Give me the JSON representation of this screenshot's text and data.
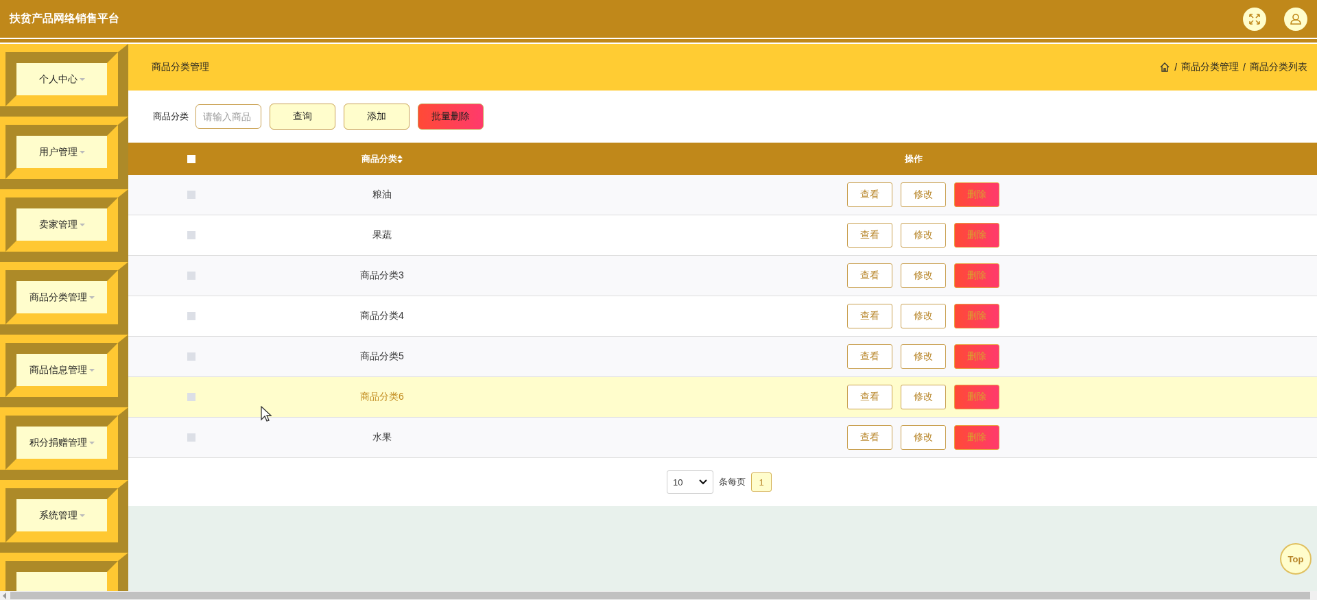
{
  "app": {
    "title": "扶贫产品网络销售平台"
  },
  "sidebar": {
    "items": [
      {
        "label": "个人中心"
      },
      {
        "label": "用户管理"
      },
      {
        "label": "卖家管理"
      },
      {
        "label": "商品分类管理"
      },
      {
        "label": "商品信息管理"
      },
      {
        "label": "积分捐赠管理"
      },
      {
        "label": "系统管理"
      }
    ]
  },
  "page_header": {
    "title": "商品分类管理",
    "breadcrumb": [
      {
        "separator": "/",
        "label": "商品分类管理"
      },
      {
        "separator": "/",
        "label": "商品分类列表"
      }
    ]
  },
  "search": {
    "label": "商品分类",
    "placeholder": "请输入商品"
  },
  "toolbar_buttons": [
    {
      "label": "查询",
      "kind": "normal"
    },
    {
      "label": "添加",
      "kind": "normal"
    },
    {
      "label": "批量删除",
      "kind": "danger"
    }
  ],
  "table": {
    "all_checked": false,
    "columns": [
      "商品分类",
      "操作"
    ],
    "rows": [
      {
        "name": "粮油",
        "checked": false,
        "hovered": false,
        "actions": [
          {
            "label": "查看",
            "kind": "view"
          },
          {
            "label": "修改",
            "kind": "edit"
          },
          {
            "label": "删除",
            "kind": "delete"
          }
        ]
      },
      {
        "name": "果蔬",
        "checked": false,
        "hovered": false,
        "actions": [
          {
            "label": "查看",
            "kind": "view"
          },
          {
            "label": "修改",
            "kind": "edit"
          },
          {
            "label": "删除",
            "kind": "delete"
          }
        ]
      },
      {
        "name": "商品分类3",
        "checked": false,
        "hovered": false,
        "actions": [
          {
            "label": "查看",
            "kind": "view"
          },
          {
            "label": "修改",
            "kind": "edit"
          },
          {
            "label": "删除",
            "kind": "delete"
          }
        ]
      },
      {
        "name": "商品分类4",
        "checked": false,
        "hovered": false,
        "actions": [
          {
            "label": "查看",
            "kind": "view"
          },
          {
            "label": "修改",
            "kind": "edit"
          },
          {
            "label": "删除",
            "kind": "delete"
          }
        ]
      },
      {
        "name": "商品分类5",
        "checked": false,
        "hovered": false,
        "actions": [
          {
            "label": "查看",
            "kind": "view"
          },
          {
            "label": "修改",
            "kind": "edit"
          },
          {
            "label": "删除",
            "kind": "delete"
          }
        ]
      },
      {
        "name": "商品分类6",
        "checked": false,
        "hovered": true,
        "actions": [
          {
            "label": "查看",
            "kind": "view"
          },
          {
            "label": "修改",
            "kind": "edit"
          },
          {
            "label": "删除",
            "kind": "delete"
          }
        ]
      },
      {
        "name": "水果",
        "checked": false,
        "hovered": false,
        "actions": [
          {
            "label": "查看",
            "kind": "view"
          },
          {
            "label": "修改",
            "kind": "edit"
          },
          {
            "label": "删除",
            "kind": "delete"
          }
        ]
      }
    ]
  },
  "pagination": {
    "page_size": "10",
    "per_page_label": "条每页",
    "pages": [
      {
        "label": "1",
        "selected": true
      }
    ]
  },
  "back_to_top": {
    "label": "Top"
  }
}
